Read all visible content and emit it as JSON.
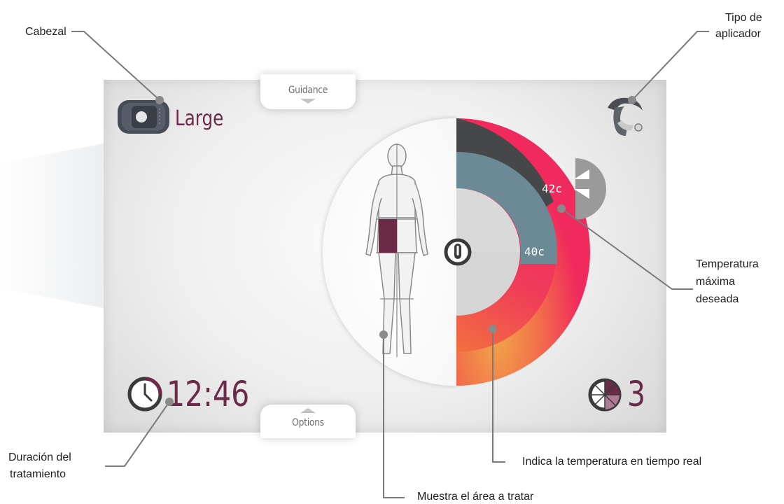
{
  "screen": {
    "top_tab_label": "Guidance",
    "bottom_tab_label": "Options",
    "head_size": "Large",
    "timer": "12:46",
    "area_count": "3",
    "max_temperature": "42c",
    "current_temperature": "40c"
  },
  "annotations": {
    "head": "Cabezal",
    "applicator_line1": "Tipo de",
    "applicator_line2": "aplicador",
    "max_temp_line1": "Temperatura",
    "max_temp_line2": "máxima",
    "max_temp_line3": "deseada",
    "duration_line1": "Duración del",
    "duration_line2": "tratamiento",
    "realtime_temp": "Indica la temperatura en tiempo real",
    "area": "Muestra el área a tratar"
  },
  "colors": {
    "accent": "#6a2a48",
    "ring_max": "#454749",
    "ring_current": "#6b8a96",
    "heat_pink": "#f02a5c",
    "heat_orange": "#f08a3c"
  },
  "icons": [
    "head-applicator-icon",
    "applicator-type-icon",
    "clock-icon",
    "thermometer-icon",
    "temperature-adjust-icon",
    "area-sectors-icon",
    "body-figure"
  ]
}
